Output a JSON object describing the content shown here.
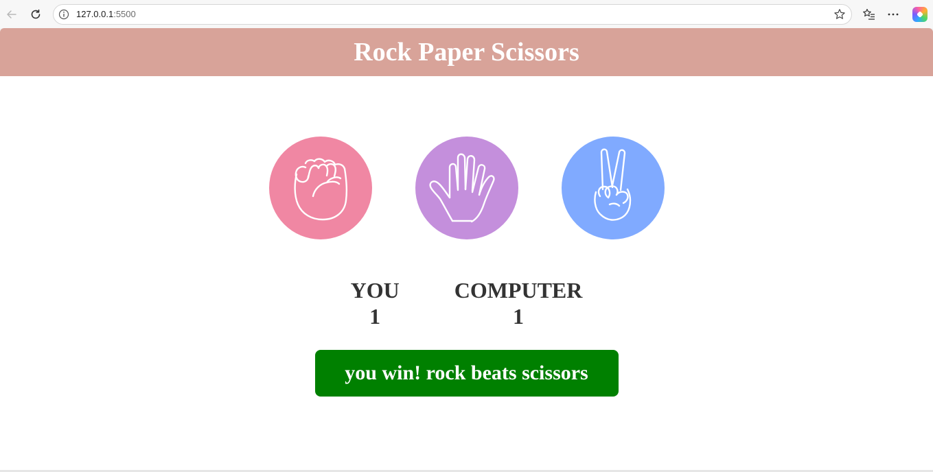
{
  "browser": {
    "url_host": "127.0.0.1",
    "url_port": ":5500",
    "icons": [
      "back-arrow-icon",
      "reload-icon",
      "info-icon",
      "star-icon",
      "favorites-icon",
      "more-icon",
      "copilot-icon"
    ]
  },
  "page": {
    "title": "Rock Paper Scissors",
    "header_color": "#d8a399"
  },
  "choices": [
    {
      "id": "rock",
      "icon": "rock-fist-icon",
      "color": "#f087a3"
    },
    {
      "id": "paper",
      "icon": "paper-hand-icon",
      "color": "#c48fdc"
    },
    {
      "id": "scissors",
      "icon": "scissors-hand-icon",
      "color": "#80aaff"
    }
  ],
  "scoreboard": {
    "user_label": "YOU",
    "user_score": "1",
    "computer_label": "COMPUTER",
    "computer_score": "1"
  },
  "message": {
    "text": "you win! rock beats scissors",
    "color": "#008000"
  }
}
